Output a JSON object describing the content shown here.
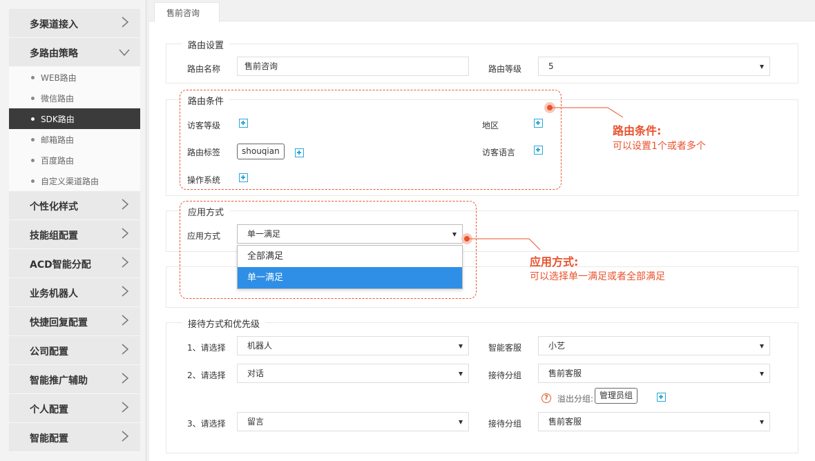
{
  "sidebar": {
    "items": [
      {
        "label": "多渠道接入"
      },
      {
        "label": "多路由策略"
      },
      {
        "label": "个性化样式"
      },
      {
        "label": "技能组配置"
      },
      {
        "label": "ACD智能分配"
      },
      {
        "label": "业务机器人"
      },
      {
        "label": "快捷回复配置"
      },
      {
        "label": "公司配置"
      },
      {
        "label": "智能推广辅助"
      },
      {
        "label": "个人配置"
      },
      {
        "label": "智能配置"
      }
    ],
    "subitems": [
      {
        "label": "WEB路由"
      },
      {
        "label": "微信路由"
      },
      {
        "label": "SDK路由"
      },
      {
        "label": "邮箱路由"
      },
      {
        "label": "百度路由"
      },
      {
        "label": "自定义渠道路由"
      }
    ],
    "active_subitem": "SDK路由"
  },
  "tab": {
    "label": "售前咨询"
  },
  "route_settings": {
    "title": "路由设置",
    "name_label": "路由名称",
    "name_value": "售前咨询",
    "level_label": "路由等级",
    "level_value": "5"
  },
  "route_conditions": {
    "title": "路由条件",
    "visitor_level_label": "访客等级",
    "region_label": "地区",
    "route_tag_label": "路由标签",
    "route_tag_value": "shouqian",
    "visitor_language_label": "访客语言",
    "os_label": "操作系统"
  },
  "apply_mode": {
    "title": "应用方式",
    "label": "应用方式",
    "value": "单一满足",
    "options": [
      "全部满足",
      "单一满足"
    ],
    "selected": "单一满足"
  },
  "reception": {
    "title": "接待方式和优先级",
    "rows": [
      {
        "label": "1、请选择",
        "mode": "机器人",
        "target_label": "智能客服",
        "target_value": "小艺"
      },
      {
        "label": "2、请选择",
        "mode": "对话",
        "target_label": "接待分组",
        "target_value": "售前客服"
      },
      {
        "label": "3、请选择",
        "mode": "留言",
        "target_label": "接待分组",
        "target_value": "售前客服"
      }
    ],
    "overflow_label": "溢出分组:",
    "overflow_tag": "管理员组"
  },
  "annotations": {
    "route_conditions_title": "路由条件:",
    "route_conditions_desc": "可以设置1个或者多个",
    "apply_mode_title": "应用方式:",
    "apply_mode_desc": "可以选择单一满足或者全部满足",
    "color": "#e9522d"
  },
  "colors": {
    "accent_orange": "#e9522d",
    "selected_blue": "#2f8fe6",
    "plus_icon": "#2aa6d6",
    "sidebar_active": "#3b3b3b"
  }
}
